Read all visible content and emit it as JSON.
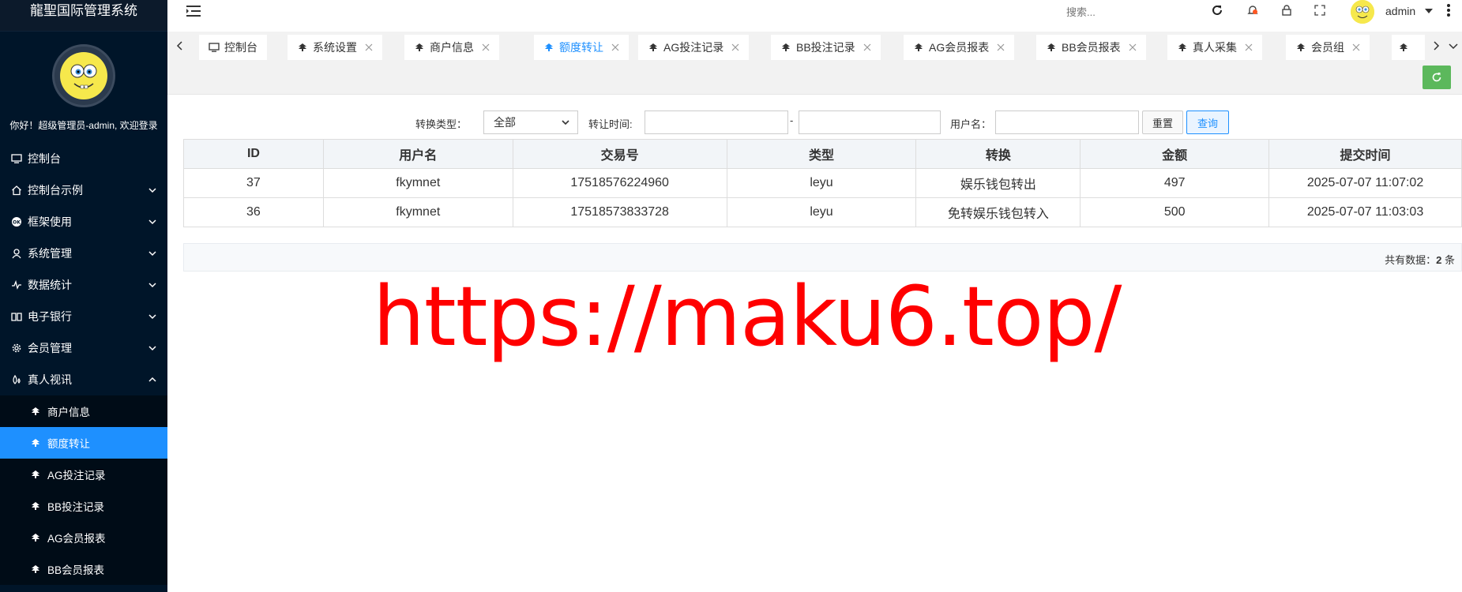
{
  "app": {
    "title": "龍聖国际管理系统",
    "welcome": "你好！超级管理员-admin, 欢迎登录"
  },
  "sidebar": {
    "items": [
      {
        "label": "控制台",
        "icon": "monitor-icon"
      },
      {
        "label": "控制台示例",
        "icon": "home-icon",
        "chevron": "down"
      },
      {
        "label": "框架使用",
        "icon": "ok-badge-icon",
        "chevron": "down"
      },
      {
        "label": "系统管理",
        "icon": "user-icon",
        "chevron": "down"
      },
      {
        "label": "数据统计",
        "icon": "pulse-icon",
        "chevron": "down"
      },
      {
        "label": "电子银行",
        "icon": "book-icon",
        "chevron": "down"
      },
      {
        "label": "会员管理",
        "icon": "gear-icon",
        "chevron": "down"
      },
      {
        "label": "真人视讯",
        "icon": "drop-icon",
        "chevron": "up"
      }
    ],
    "subitems": [
      {
        "label": "商户信息",
        "icon": "tree-icon"
      },
      {
        "label": "额度转让",
        "icon": "tree-icon",
        "active": true
      },
      {
        "label": "AG投注记录",
        "icon": "tree-icon"
      },
      {
        "label": "BB投注记录",
        "icon": "tree-icon"
      },
      {
        "label": "AG会员报表",
        "icon": "tree-icon"
      },
      {
        "label": "BB会员报表",
        "icon": "tree-icon"
      }
    ]
  },
  "header": {
    "search_placeholder": "搜索...",
    "user": "admin"
  },
  "tabs": [
    {
      "label": "控制台",
      "icon": "monitor-icon",
      "closable": false
    },
    {
      "label": "系统设置",
      "icon": "tree-icon",
      "closable": true
    },
    {
      "label": "商户信息",
      "icon": "tree-icon",
      "closable": true
    },
    {
      "label": "额度转让",
      "icon": "tree-icon",
      "closable": true,
      "active": true
    },
    {
      "label": "AG投注记录",
      "icon": "tree-icon",
      "closable": true
    },
    {
      "label": "BB投注记录",
      "icon": "tree-icon",
      "closable": true
    },
    {
      "label": "AG会员报表",
      "icon": "tree-icon",
      "closable": true
    },
    {
      "label": "BB会员报表",
      "icon": "tree-icon",
      "closable": true
    },
    {
      "label": "真人采集",
      "icon": "tree-icon",
      "closable": true
    },
    {
      "label": "会员组",
      "icon": "tree-icon",
      "closable": true
    }
  ],
  "filter": {
    "type_label": "转换类型：",
    "type_value": "全部",
    "time_label": "转让时间:",
    "dash": "-",
    "user_label": "用户名：",
    "reset": "重置",
    "search": "查询"
  },
  "table": {
    "headers": [
      "ID",
      "用户名",
      "交易号",
      "类型",
      "转换",
      "金额",
      "提交时间"
    ],
    "rows": [
      [
        "37",
        "fkymnet",
        "17518576224960",
        "leyu",
        "娱乐钱包转出",
        "497",
        "2025-07-07 11:07:02"
      ],
      [
        "36",
        "fkymnet",
        "17518573833728",
        "leyu",
        "免转娱乐钱包转入",
        "500",
        "2025-07-07 11:03:03"
      ]
    ]
  },
  "footer": {
    "total_prefix": "共有数据：",
    "total_count": "2",
    "total_suffix": " 条"
  },
  "watermark": "https://maku6.top/",
  "colors": {
    "sidebar_bg": "#001529",
    "active_blue": "#1e90ff",
    "refresh_green": "#5cb85c",
    "watermark_red": "#ff0000"
  }
}
